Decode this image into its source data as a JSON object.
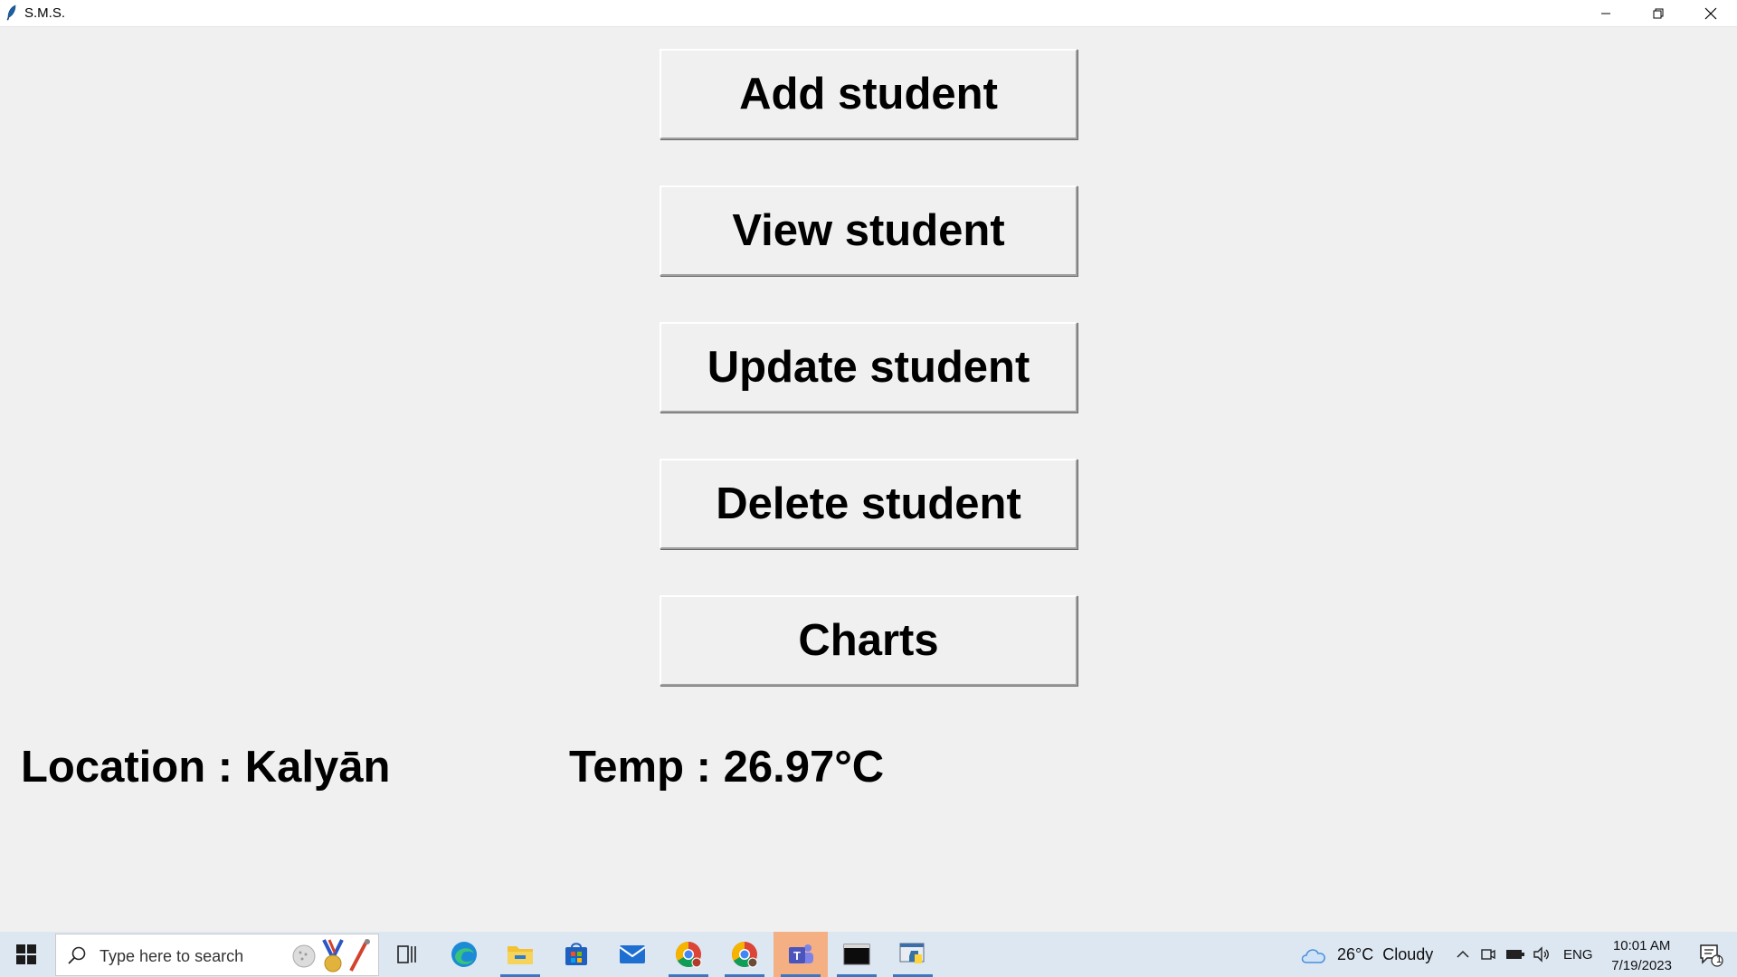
{
  "window": {
    "title": "S.M.S.",
    "controls": {
      "minimize": "minimize-icon",
      "restore": "restore-icon",
      "close": "close-icon"
    }
  },
  "menu": {
    "buttons": [
      {
        "label": "Add student"
      },
      {
        "label": "View student"
      },
      {
        "label": "Update student"
      },
      {
        "label": "Delete student"
      },
      {
        "label": "Charts"
      }
    ]
  },
  "info": {
    "location": "Location : Kalyān",
    "temp": "Temp : 26.97°C"
  },
  "taskbar": {
    "search_placeholder": "Type here to search",
    "apps": [
      "task-view-icon",
      "edge-icon",
      "file-explorer-icon",
      "store-icon",
      "mail-icon",
      "chrome-icon",
      "chrome-profile-icon",
      "teams-icon",
      "terminal-icon",
      "python-icon"
    ],
    "weather": {
      "temp": "26°C",
      "condition": "Cloudy"
    },
    "language": "ENG",
    "time": "10:01 AM",
    "date": "7/19/2023",
    "notification_count": "1"
  }
}
